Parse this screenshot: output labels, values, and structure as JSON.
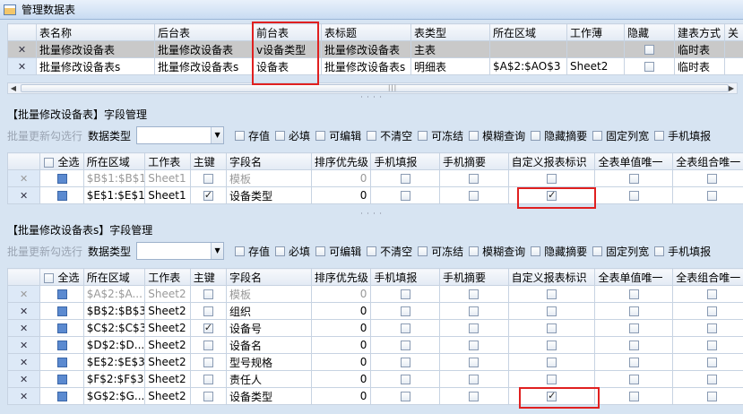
{
  "window": {
    "title": "管理数据表"
  },
  "tables_grid": {
    "columns": [
      "表名称",
      "后台表",
      "前台表",
      "表标题",
      "表类型",
      "所在区域",
      "工作薄",
      "隐藏",
      "建表方式",
      "关"
    ],
    "rows": [
      {
        "table_name": "批量修改设备表",
        "backend": "批量修改设备表",
        "frontend": "v设备类型",
        "title": "批量修改设备表",
        "type": "主表",
        "area": "",
        "workbook": "",
        "hidden": false,
        "build_mode": "临时表"
      },
      {
        "table_name": "批量修改设备表s",
        "backend": "批量修改设备表s",
        "frontend": "设备表",
        "title": "批量修改设备表s",
        "type": "明细表",
        "area": "$A$2:$AO$3",
        "workbook": "Sheet2",
        "hidden": false,
        "build_mode": "临时表"
      }
    ]
  },
  "field_mgmt_1": {
    "title": "【批量修改设备表】字段管理",
    "refresh_label": "批量更新勾选行",
    "data_type_label": "数据类型",
    "data_type_value": "",
    "options": [
      "存值",
      "必填",
      "可编辑",
      "不清空",
      "可冻结",
      "模糊查询",
      "隐藏摘要",
      "固定列宽",
      "手机填报"
    ],
    "columns": [
      "全选",
      "所在区域",
      "工作表",
      "主键",
      "字段名",
      "排序优先级",
      "手机填报",
      "手机摘要",
      "自定义报表标识",
      "全表单值唯一",
      "全表组合唯一"
    ],
    "rows": [
      {
        "area": "$B$1:$B$1",
        "sheet": "Sheet1",
        "pk": false,
        "field": "模板",
        "priority": "0",
        "custom": false,
        "gray": true
      },
      {
        "area": "$E$1:$E$1",
        "sheet": "Sheet1",
        "pk": true,
        "field": "设备类型",
        "priority": "0",
        "custom": true,
        "gray": false
      }
    ]
  },
  "field_mgmt_2": {
    "title": "【批量修改设备表s】字段管理",
    "refresh_label": "批量更新勾选行",
    "data_type_label": "数据类型",
    "data_type_value": "",
    "options": [
      "存值",
      "必填",
      "可编辑",
      "不清空",
      "可冻结",
      "模糊查询",
      "隐藏摘要",
      "固定列宽",
      "手机填报"
    ],
    "columns": [
      "全选",
      "所在区域",
      "工作表",
      "主键",
      "字段名",
      "排序优先级",
      "手机填报",
      "手机摘要",
      "自定义报表标识",
      "全表单值唯一",
      "全表组合唯一"
    ],
    "rows": [
      {
        "area": "$A$2:$A...",
        "sheet": "Sheet2",
        "pk": false,
        "field": "模板",
        "priority": "0",
        "custom": false,
        "gray": true
      },
      {
        "area": "$B$2:$B$3",
        "sheet": "Sheet2",
        "pk": false,
        "field": "组织",
        "priority": "0",
        "custom": false,
        "gray": false
      },
      {
        "area": "$C$2:$C$3",
        "sheet": "Sheet2",
        "pk": true,
        "field": "设备号",
        "priority": "0",
        "custom": false,
        "gray": false
      },
      {
        "area": "$D$2:$D...",
        "sheet": "Sheet2",
        "pk": false,
        "field": "设备名",
        "priority": "0",
        "custom": false,
        "gray": false
      },
      {
        "area": "$E$2:$E$3",
        "sheet": "Sheet2",
        "pk": false,
        "field": "型号规格",
        "priority": "0",
        "custom": false,
        "gray": false
      },
      {
        "area": "$F$2:$F$3",
        "sheet": "Sheet2",
        "pk": false,
        "field": "责任人",
        "priority": "0",
        "custom": false,
        "gray": false
      },
      {
        "area": "$G$2:$G...",
        "sheet": "Sheet2",
        "pk": false,
        "field": "设备类型",
        "priority": "0",
        "custom": true,
        "gray": false
      }
    ]
  },
  "icons": {
    "delete_row": "close-icon",
    "dropdown": "chevron-down-icon",
    "splitter": "drag-grip-icon"
  },
  "colors": {
    "highlight": "#e02020",
    "header": "#e3eaf4",
    "selected_row": "#c9c9c9"
  }
}
